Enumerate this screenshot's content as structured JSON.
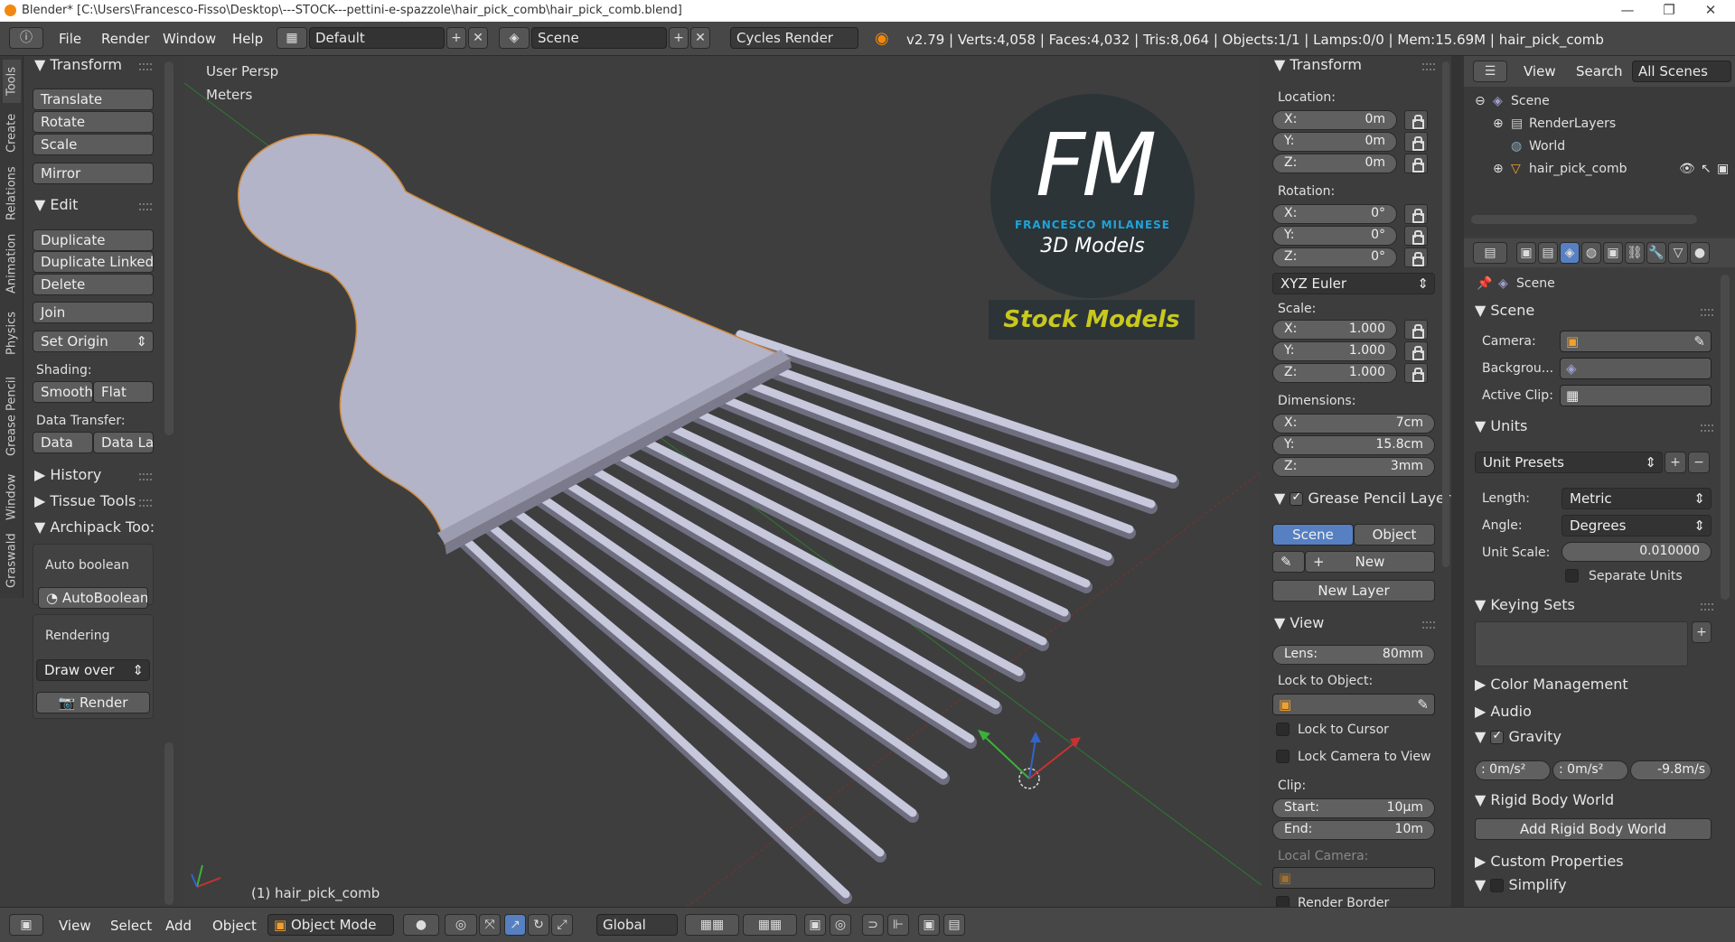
{
  "window": {
    "title": "Blender* [C:\\Users\\Francesco-Fisso\\Desktop\\---STOCK---pettini-e-spazzole\\hair_pick_comb\\hair_pick_comb.blend]",
    "minimize": "—",
    "restore": "❐",
    "close": "✕"
  },
  "top_menu": {
    "items": [
      "File",
      "Render",
      "Window",
      "Help"
    ],
    "screen_layout": "Default",
    "scene": "Scene",
    "engine": "Cycles Render",
    "stats": "v2.79 | Verts:4,058 | Faces:4,032 | Tris:8,064 | Objects:1/1 | Lamps:0/0 | Mem:15.69M | hair_pick_comb"
  },
  "tool_tabs": [
    "Tools",
    "Create",
    "Relations",
    "Animation",
    "Physics",
    "Grease Pencil",
    "Window",
    "Graswald"
  ],
  "tool_shelf": {
    "transform_header": "Transform",
    "translate": "Translate",
    "rotate": "Rotate",
    "scale": "Scale",
    "mirror": "Mirror",
    "edit_header": "Edit",
    "duplicate": "Duplicate",
    "duplicate_linked": "Duplicate Linked",
    "delete": "Delete",
    "join": "Join",
    "set_origin": "Set Origin",
    "shading_label": "Shading:",
    "smooth": "Smooth",
    "flat": "Flat",
    "data_transfer_label": "Data Transfer:",
    "data": "Data",
    "data_la": "Data La",
    "history_header": "History",
    "tissue_header": "Tissue Tools",
    "archipack_header": "Archipack Too:",
    "auto_boolean_label": "Auto boolean",
    "auto_boolean_btn": "AutoBoolean",
    "rendering_label": "Rendering",
    "draw_over": "Draw over",
    "render_btn": "Render"
  },
  "viewport": {
    "view_name": "User Persp",
    "units": "Meters",
    "object_label": "(1) hair_pick_comb",
    "logo_letters": "FM",
    "logo_name": "FRANCESCO MILANESE",
    "logo_sub": "3D Models",
    "stock_banner": "Stock Models"
  },
  "n_panel": {
    "transform_header": "Transform",
    "location_label": "Location:",
    "loc": [
      {
        "axis": "X:",
        "value": "0m"
      },
      {
        "axis": "Y:",
        "value": "0m"
      },
      {
        "axis": "Z:",
        "value": "0m"
      }
    ],
    "rotation_label": "Rotation:",
    "rot": [
      {
        "axis": "X:",
        "value": "0°"
      },
      {
        "axis": "Y:",
        "value": "0°"
      },
      {
        "axis": "Z:",
        "value": "0°"
      }
    ],
    "rotation_mode": "XYZ Euler",
    "scale_label": "Scale:",
    "scl": [
      {
        "axis": "X:",
        "value": "1.000"
      },
      {
        "axis": "Y:",
        "value": "1.000"
      },
      {
        "axis": "Z:",
        "value": "1.000"
      }
    ],
    "dimensions_label": "Dimensions:",
    "dim": [
      {
        "axis": "X:",
        "value": "7cm"
      },
      {
        "axis": "Y:",
        "value": "15.8cm"
      },
      {
        "axis": "Z:",
        "value": "3mm"
      }
    ],
    "gp_layer_header": "Grease Pencil Layer",
    "gp_scene": "Scene",
    "gp_object": "Object",
    "gp_new": "New",
    "gp_new_layer": "New Layer",
    "view_header": "View",
    "lens_label": "Lens:",
    "lens_value": "80mm",
    "lock_to_object": "Lock to Object:",
    "lock_to_cursor": "Lock to Cursor",
    "lock_camera": "Lock Camera to View",
    "clip_label": "Clip:",
    "clip_start_label": "Start:",
    "clip_start": "10µm",
    "clip_end_label": "End:",
    "clip_end": "10m",
    "local_camera": "Local Camera:",
    "render_border": "Render Border"
  },
  "outliner": {
    "view": "View",
    "search": "Search",
    "all_scenes": "All Scenes",
    "items": [
      "Scene",
      "RenderLayers",
      "World",
      "hair_pick_comb"
    ]
  },
  "properties": {
    "context": "Scene",
    "scene_header": "Scene",
    "camera_label": "Camera:",
    "background_label": "Backgrou...",
    "active_clip_label": "Active Clip:",
    "units_header": "Units",
    "unit_presets": "Unit Presets",
    "length_label": "Length:",
    "length_value": "Metric",
    "angle_label": "Angle:",
    "angle_value": "Degrees",
    "unit_scale_label": "Unit Scale:",
    "unit_scale_value": "0.010000",
    "separate_units": "Separate Units",
    "keying_sets_header": "Keying Sets",
    "color_mgmt_header": "Color Management",
    "audio_header": "Audio",
    "gravity_header": "Gravity",
    "gravity_x": ": 0m/s²",
    "gravity_y": ": 0m/s²",
    "gravity_z": "-9.8m/s",
    "rigid_body_header": "Rigid Body World",
    "add_rigid_body": "Add Rigid Body World",
    "custom_props_header": "Custom Properties",
    "simplify_header": "Simplify"
  },
  "bottom_bar": {
    "view": "View",
    "select": "Select",
    "add": "Add",
    "object": "Object",
    "mode": "Object Mode",
    "orientation": "Global"
  },
  "colors": {
    "accent_blue": "#5680c2",
    "comb_color": "#b4b4c8",
    "logo_blue": "#1fa3d8",
    "stock_yellow": "#c8c81e"
  }
}
